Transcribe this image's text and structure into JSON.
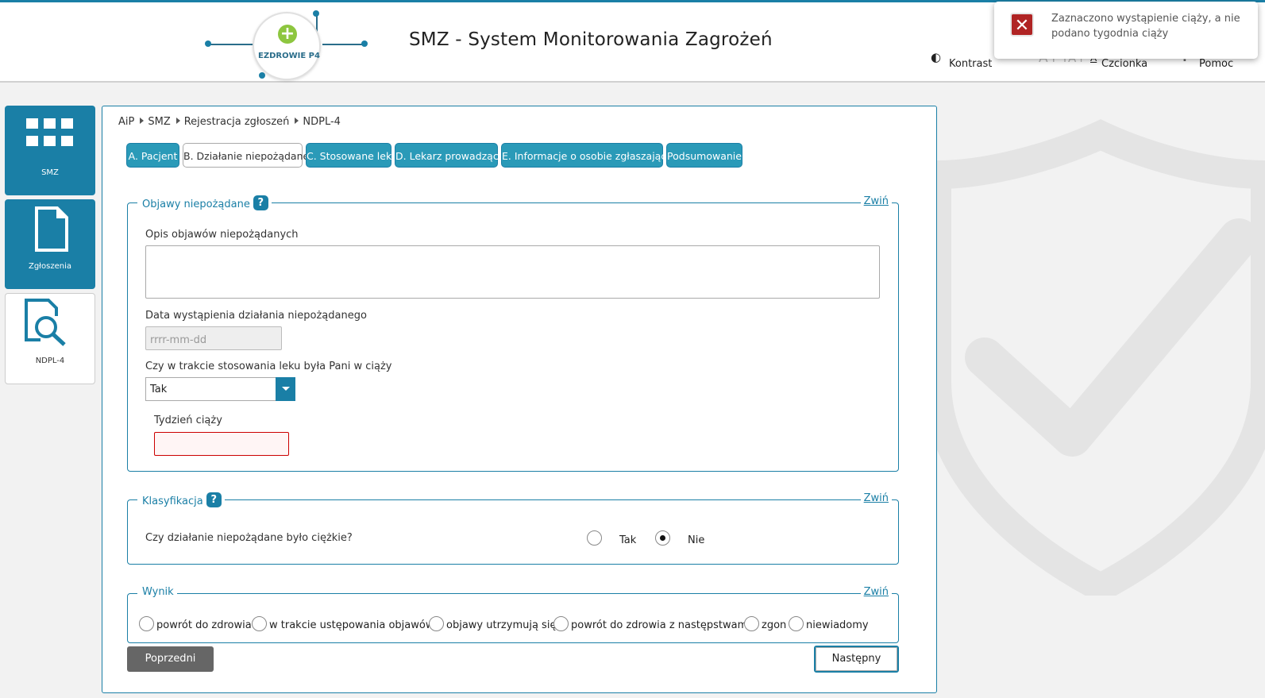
{
  "header": {
    "logo_text": "EZDROWIE P4",
    "title": "SMZ - System Monitorowania Zagrożeń",
    "tools": {
      "contrast": "Kontrast",
      "font": "Czcionka",
      "font_bigger": "A++",
      "font_big": "A+",
      "font_normal": "A",
      "help": "Pomoc",
      "help_icon_glyph": "?"
    }
  },
  "toast": {
    "message": "Zaznaczono wystąpienie ciąży, a nie podano tygodnia ciąży"
  },
  "sidebar": {
    "items": [
      {
        "label": "SMZ",
        "icon": "grid-icon"
      },
      {
        "label": "Zgłoszenia",
        "icon": "document-icon"
      },
      {
        "label": "NDPL-4",
        "icon": "document-search-icon"
      }
    ]
  },
  "breadcrumb": [
    "AiP",
    "SMZ",
    "Rejestracja zgłoszeń",
    "NDPL-4"
  ],
  "tabs": [
    "A. Pacjent",
    "B. Działanie niepożądane",
    "C. Stosowane leki",
    "D. Lekarz prowadzący",
    "E. Informacje o osobie zgłaszającej",
    "Podsumowanie"
  ],
  "active_tab": 1,
  "sections": {
    "symptoms": {
      "legend": "Objawy niepożądane",
      "help": "?",
      "collapse": "Zwiń",
      "description_label": "Opis objawów niepożądanych",
      "description_value": "",
      "date_label": "Data wystąpienia działania niepożądanego",
      "date_placeholder": "rrrr-mm-dd",
      "pregnancy_label": "Czy w trakcie stosowania leku była Pani w ciąży",
      "pregnancy_value": "Tak",
      "week_label": "Tydzień ciąży",
      "week_value": ""
    },
    "classification": {
      "legend": "Klasyfikacja",
      "help": "?",
      "collapse": "Zwiń",
      "question": "Czy działanie niepożądane było ciężkie?",
      "options": [
        "Tak",
        "Nie"
      ],
      "selected": "Nie"
    },
    "outcome": {
      "legend": "Wynik",
      "collapse": "Zwiń",
      "options": [
        "powrót do zdrowia",
        "w trakcie ustępowania objawów",
        "objawy utrzymują się",
        "powrót do zdrowia z następstwami",
        "zgon",
        "niewiadomy"
      ]
    }
  },
  "buttons": {
    "prev": "Poprzedni",
    "next": "Następny"
  },
  "colors": {
    "accent": "#1a7fa6",
    "tab": "#2a9ab8",
    "error": "#cc0000",
    "toast_icon": "#b02424"
  }
}
